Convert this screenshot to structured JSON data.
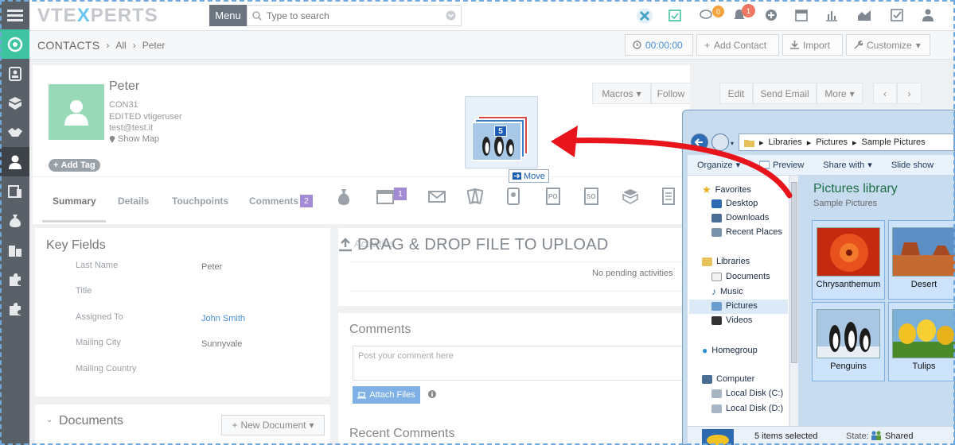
{
  "topbar": {
    "logo_left": "VTE",
    "logo_x": "X",
    "logo_right": "PERTS",
    "menu_label": "Menu",
    "search_placeholder": "Type to search",
    "chat_badge": "0",
    "notif_badge": "1"
  },
  "breadcrumb": {
    "module": "CONTACTS",
    "filter": "All",
    "record": "Peter"
  },
  "header_actions": {
    "timer": "00:00:00",
    "add_contact": "Add Contact",
    "import": "Import",
    "customize": "Customize"
  },
  "record": {
    "name": "Peter",
    "number": "CON31",
    "edited": "EDITED vtigeruser",
    "email": "test@test.it",
    "show_map": "Show Map",
    "add_tag": "Add Tag"
  },
  "record_actions": {
    "macros": "Macros",
    "follow": "Follow",
    "edit": "Edit",
    "send_email": "Send Email",
    "more": "More"
  },
  "tabs": [
    {
      "label": "Summary",
      "active": true
    },
    {
      "label": "Details"
    },
    {
      "label": "Touchpoints"
    },
    {
      "label": "Comments",
      "count": "2"
    }
  ],
  "calendar_badge": "1",
  "key_fields": {
    "title": "Key Fields",
    "rows": [
      {
        "label": "Last Name",
        "value": "Peter"
      },
      {
        "label": "Title",
        "value": ""
      },
      {
        "label": "Assigned To",
        "value": "John Smith"
      },
      {
        "label": "Mailing City",
        "value": "Sunnyvale"
      },
      {
        "label": "Mailing Country",
        "value": ""
      }
    ]
  },
  "activities": {
    "drop_text": "DRAG & DROP FILE TO UPLOAD",
    "no_pending": "No pending activities",
    "overlap_text": "Activities"
  },
  "comments": {
    "title": "Comments",
    "placeholder": "Post your comment here",
    "attach": "Attach Files",
    "recent": "Recent Comments"
  },
  "documents": {
    "title": "Documents",
    "new_doc": "New Document"
  },
  "drag": {
    "count": "5",
    "move": "Move"
  },
  "explorer": {
    "path": [
      "Libraries",
      "Pictures",
      "Sample Pictures"
    ],
    "toolbar": {
      "organize": "Organize",
      "preview": "Preview",
      "share": "Share with",
      "slideshow": "Slide show"
    },
    "nav": {
      "favorites": "Favorites",
      "desktop": "Desktop",
      "downloads": "Downloads",
      "recent": "Recent Places",
      "libraries": "Libraries",
      "documents": "Documents",
      "music": "Music",
      "pictures": "Pictures",
      "videos": "Videos",
      "homegroup": "Homegroup",
      "computer": "Computer",
      "disk_c": "Local Disk (C:)",
      "disk_d": "Local Disk (D:)"
    },
    "library_title": "Pictures library",
    "library_sub": "Sample Pictures",
    "items": [
      "Chrysanthemum",
      "Desert",
      "Penguins",
      "Tulips"
    ],
    "status_count": "5 items selected",
    "status_state_label": "State:",
    "status_state_value": "Shared"
  },
  "colors": {
    "accent_green": "#3ec4a0",
    "rail": "#596067",
    "link_blue": "#4a8fd6",
    "arrow_red": "#e8141c",
    "attach_blue": "#7fb1e6"
  }
}
